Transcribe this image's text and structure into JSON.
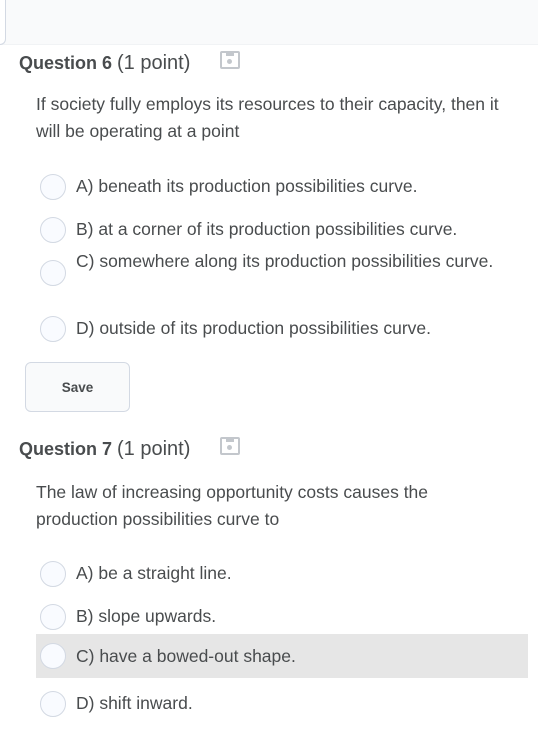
{
  "questions": [
    {
      "title": "Question 6",
      "points": "(1 point)",
      "text": "If society fully employs its resources to their capacity, then it will be operating at a point",
      "options": [
        "A) beneath its production possibilities curve.",
        "B) at a corner of its production possibilities curve.",
        "C) somewhere along its production possibilities curve.",
        "D) outside of its production possibilities curve."
      ],
      "save_label": "Save"
    },
    {
      "title": "Question 7",
      "points": "(1 point)",
      "text": "The law of increasing opportunity costs causes the production possibilities curve to",
      "options": [
        "A) be a straight line.",
        "B) slope upwards.",
        "C) have a bowed-out shape.",
        "D) shift inward."
      ],
      "highlighted_option": "C) have a bowed-out shape."
    }
  ],
  "icons": {
    "bookmark": "bookmark-icon",
    "radio": "radio-unselected"
  },
  "colors": {
    "text": "#494c4e",
    "highlight_row": "#e6e6e6",
    "radio_border": "#d3d9e3"
  }
}
